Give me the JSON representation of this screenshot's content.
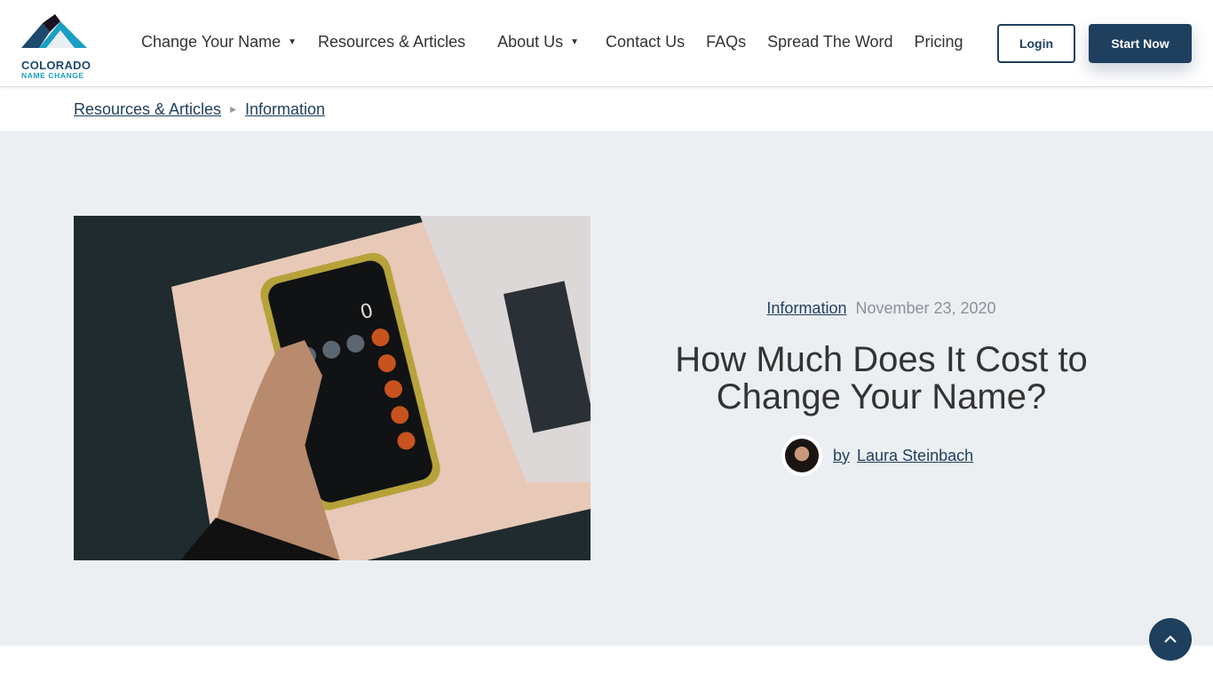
{
  "logo": {
    "line1": "COLORADO",
    "line2": "NAME CHANGE"
  },
  "nav": {
    "items": [
      {
        "label": "Change Your Name",
        "dropdown": true
      },
      {
        "label": "Resources & Articles",
        "dropdown": false
      },
      {
        "label": "About Us",
        "dropdown": true
      },
      {
        "label": "Contact Us",
        "dropdown": false
      },
      {
        "label": "FAQs",
        "dropdown": false
      },
      {
        "label": "Spread The Word",
        "dropdown": false
      },
      {
        "label": "Pricing",
        "dropdown": false
      }
    ],
    "caret": "▼"
  },
  "buttons": {
    "login": "Login",
    "start": "Start Now",
    "back_to_top": "⌃"
  },
  "breadcrumb": {
    "items": [
      "Resources & Articles",
      "Information"
    ],
    "sep": "▶"
  },
  "article": {
    "category": "Information",
    "date": "November 23, 2020",
    "title": "How Much Does It Cost to Change Your Name?",
    "by": "by",
    "author": "Laura Steinbach"
  },
  "colors": {
    "brand": "#1e3f5e",
    "accent": "#1a9fc4",
    "hero_bg": "#eceff2"
  }
}
